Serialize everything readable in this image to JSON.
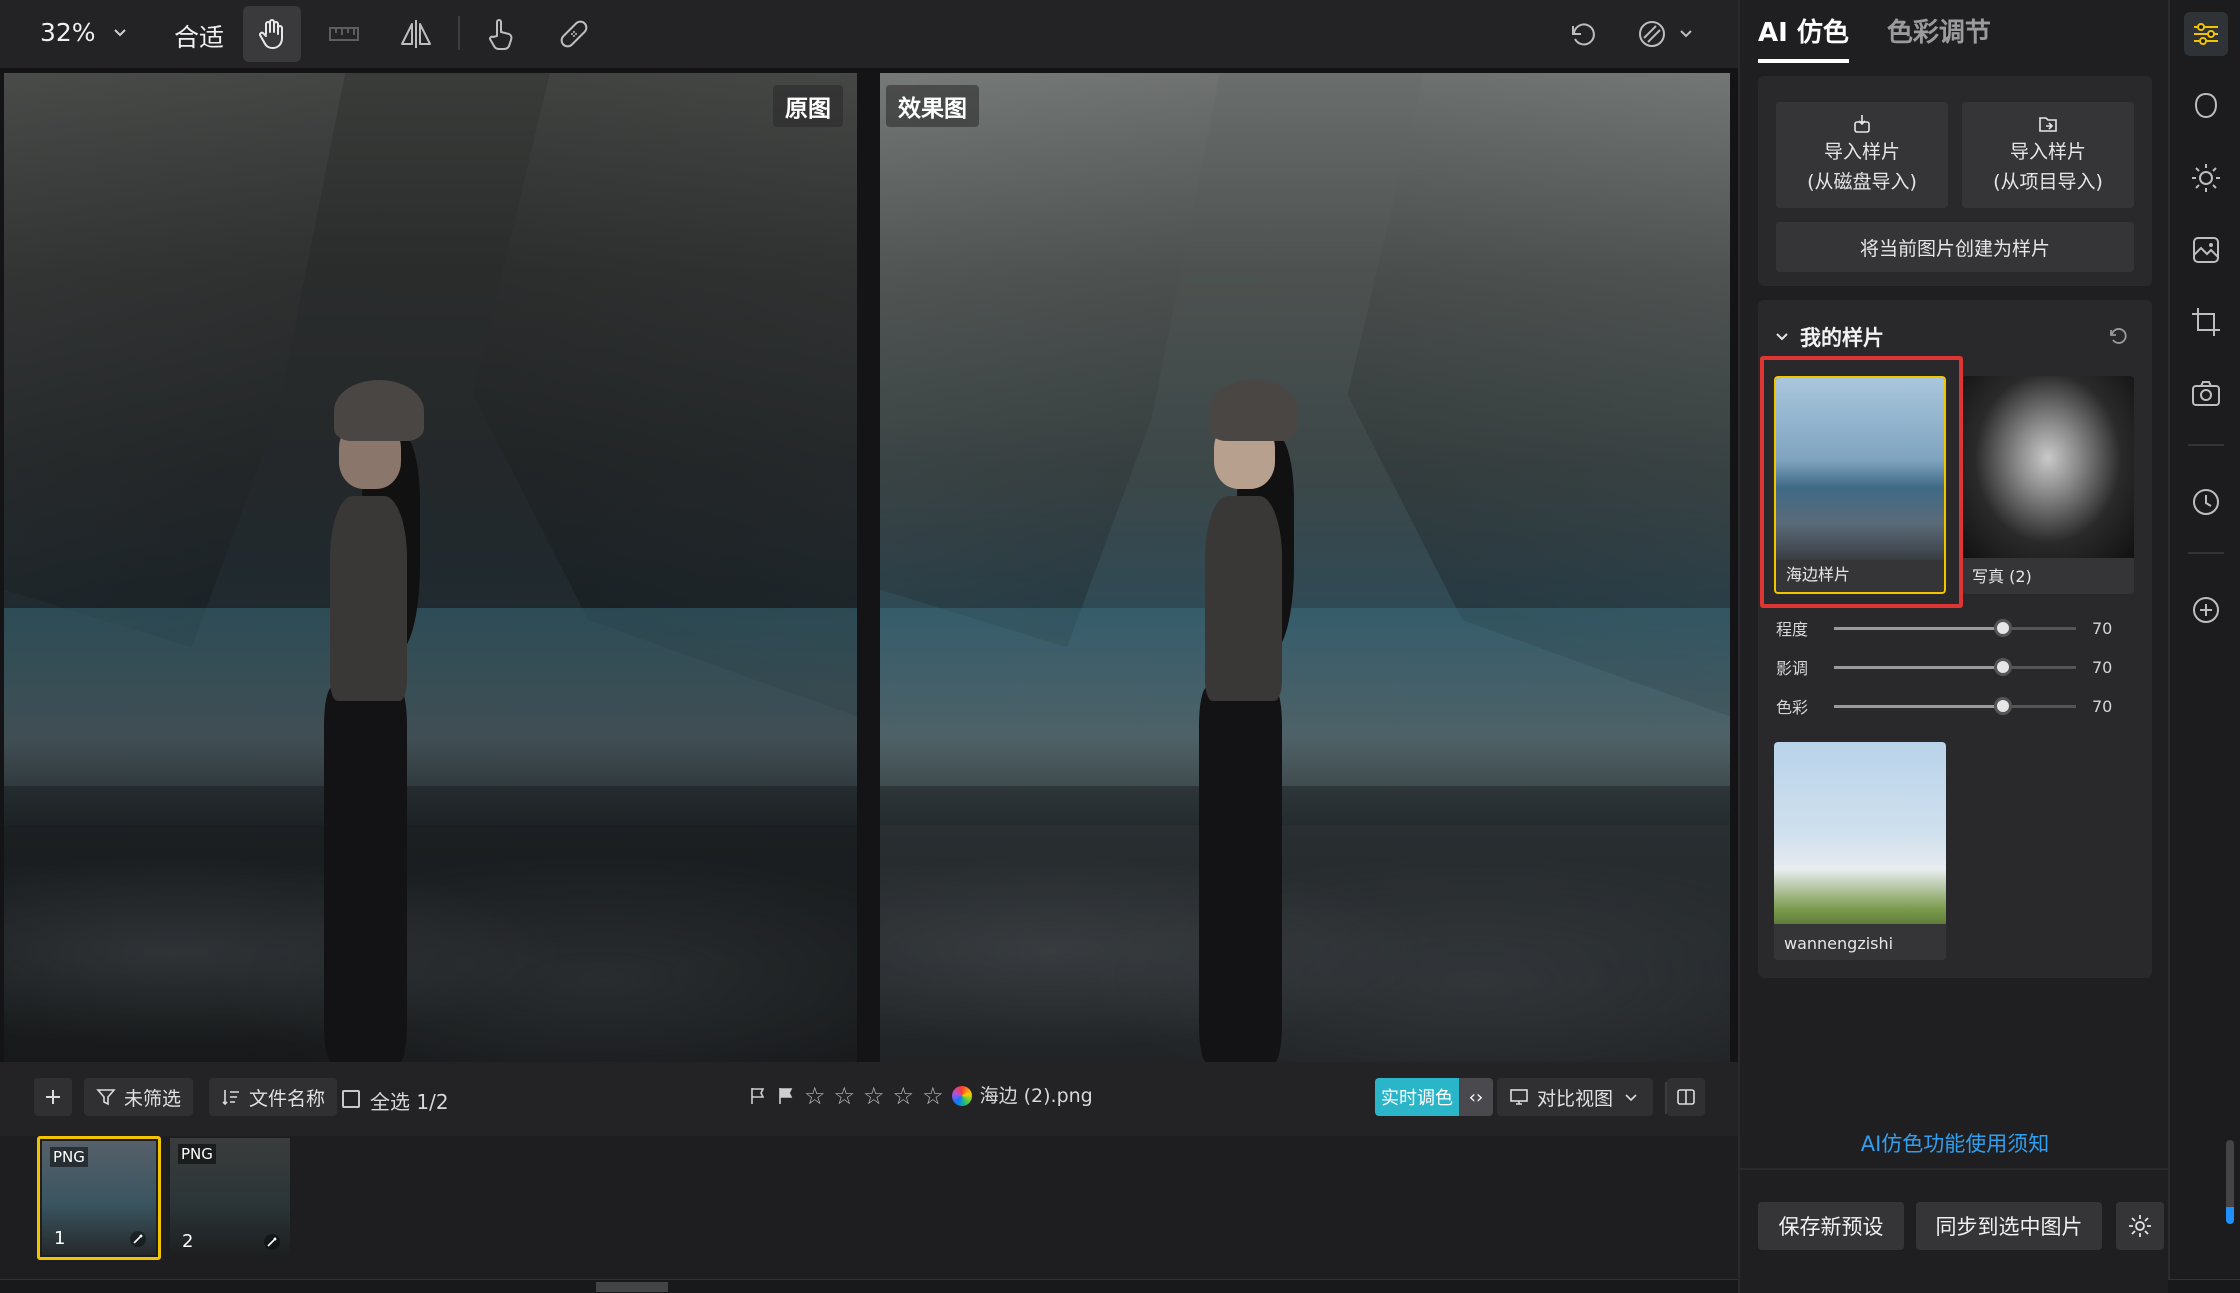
{
  "toolbar": {
    "zoom": "32%",
    "fit": "合适"
  },
  "canvas": {
    "original_label": "原图",
    "effect_label": "效果图"
  },
  "bottombar": {
    "filter_label": "未筛选",
    "sort_label": "文件名称",
    "select_all_label": "全选 1/2",
    "file_name": "海边 (2).png",
    "realtime_label": "实时调色",
    "compare_label": "对比视图"
  },
  "thumbnails": [
    {
      "tag": "PNG",
      "num": "1"
    },
    {
      "tag": "PNG",
      "num": "2"
    }
  ],
  "panel": {
    "tabs": [
      {
        "label": "AI 仿色"
      },
      {
        "label": "色彩调节"
      }
    ],
    "import_disk_line1": "导入样片",
    "import_disk_line2": "(从磁盘导入)",
    "import_project_line1": "导入样片",
    "import_project_line2": "(从项目导入)",
    "create_sample": "将当前图片创建为样片",
    "my_samples_title": "我的样片",
    "samples": [
      {
        "caption": "海边样片"
      },
      {
        "caption": "写真 (2)"
      },
      {
        "caption": "wannengzishi"
      }
    ],
    "sliders": [
      {
        "label": "程度",
        "value": 70
      },
      {
        "label": "影调",
        "value": 70
      },
      {
        "label": "色彩",
        "value": 70
      }
    ],
    "notice_link": "AI仿色功能使用须知",
    "save_preset": "保存新预设",
    "sync_to_selected": "同步到选中图片"
  },
  "colors": {
    "accent_yellow": "#f2c400",
    "highlight_red": "#e03535",
    "link_blue": "#2f9ff0",
    "realtime_cyan": "#2ab6c8"
  }
}
